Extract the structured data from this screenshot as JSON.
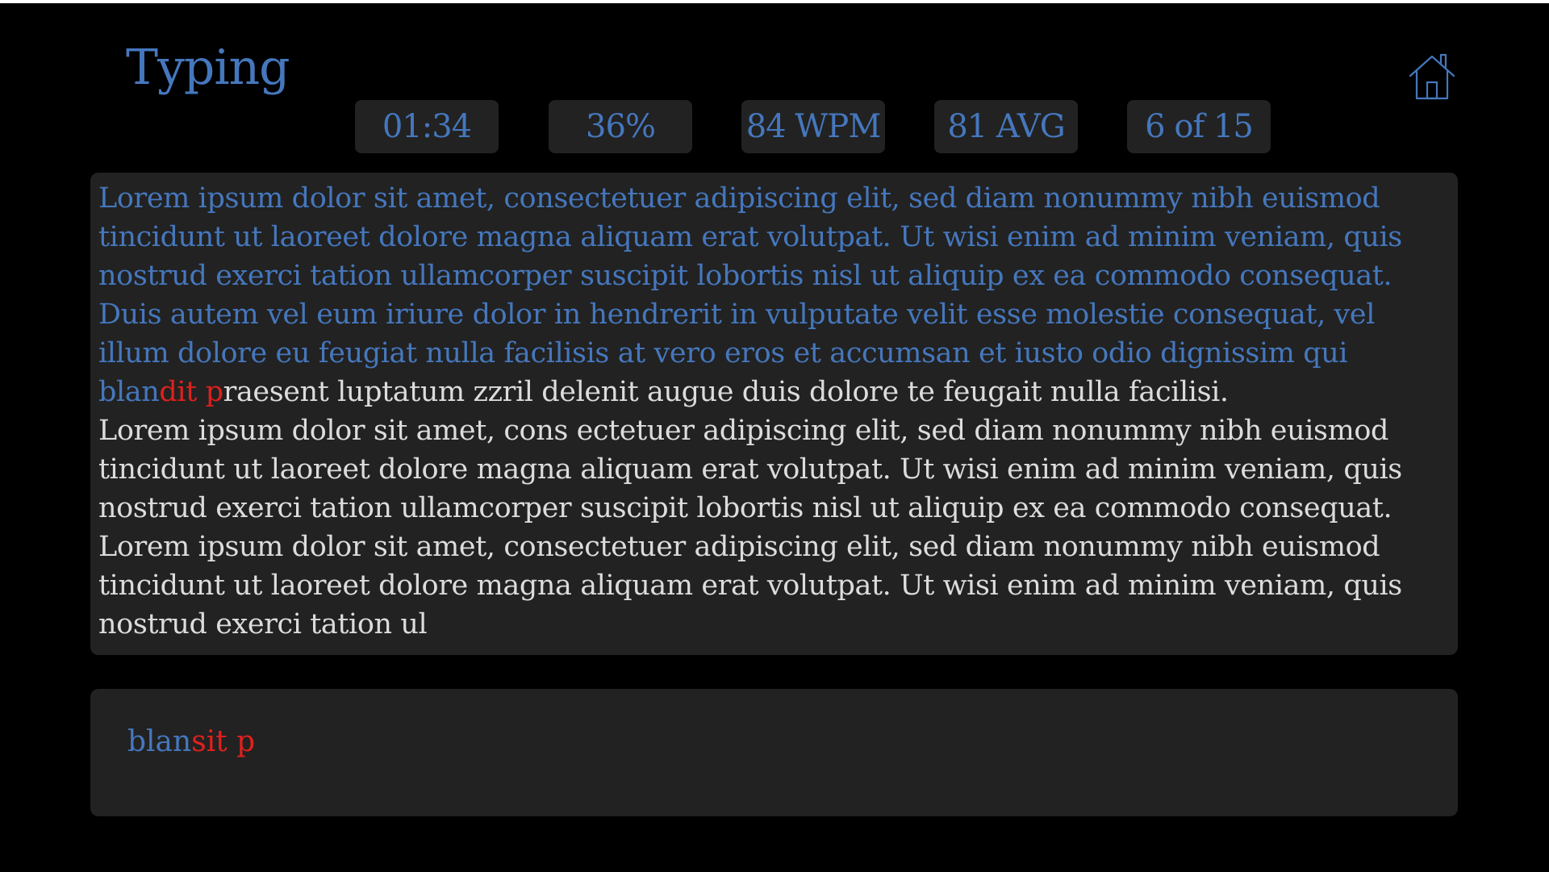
{
  "app": {
    "title": "Typing"
  },
  "stats": {
    "timer": "01:34",
    "progress": "36%",
    "wpm": "84 WPM",
    "average": "81 AVG",
    "page": "6 of 15"
  },
  "passage": {
    "typed": "Lorem ipsum dolor sit amet, consectetuer adipiscing elit, sed diam nonummy nibh euismod tincidunt ut laoreet dolore magna aliquam erat volutpat. Ut wisi enim ad minim veniam, quis nostrud exerci tation ullamcorper suscipit lobortis nisl ut aliquip ex ea commodo consequat. Duis autem vel eum iriure dolor in hendrerit in vulputate velit esse molestie consequat, vel illum dolore eu feugiat nulla facilisis at vero eros et accumsan et iusto odio dignissim qui blan",
    "error": "dit p",
    "remaining": "raesent luptatum zzril delenit augue duis dolore te feugait nulla facilisi.",
    "paragraph2": "Lorem ipsum dolor sit amet, cons ectetuer adipiscing elit, sed diam nonummy nibh euismod tincidunt ut laoreet dolore magna aliquam erat volutpat. Ut wisi enim ad minim veniam, quis nostrud exerci tation ullamcorper suscipit lobortis nisl ut aliquip ex ea commodo consequat.",
    "paragraph3": "Lorem ipsum dolor sit amet, consectetuer adipiscing elit, sed diam nonummy nibh euismod tincidunt ut laoreet dolore magna aliquam erat volutpat. Ut wisi enim ad minim veniam, quis nostrud exerci tation ul"
  },
  "input": {
    "correct": "blan",
    "incorrect": "sit p"
  },
  "icons": {
    "home": "home-icon"
  },
  "colors": {
    "background": "#000000",
    "panel": "#222222",
    "accent": "#4577bd",
    "error": "#e0201c",
    "text": "#dcdcdc"
  }
}
